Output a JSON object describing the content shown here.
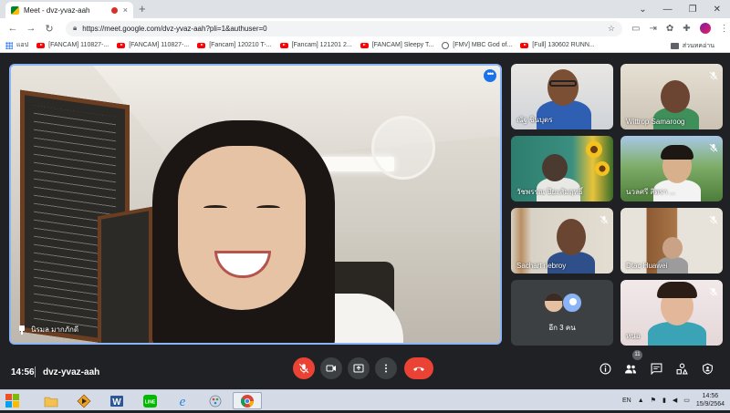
{
  "browser": {
    "tab_title": "Meet - dvz-yvaz-aah",
    "tab_close": "×",
    "new_tab": "+",
    "url": "https://meet.google.com/dvz-yvaz-aah?pli=1&authuser=0",
    "bookmarks": [
      {
        "icon": "apps-icon",
        "label": "แอป"
      },
      {
        "icon": "youtube-icon",
        "label": "[FANCAM] 110827-..."
      },
      {
        "icon": "youtube-icon",
        "label": "[FANCAM] 110827-..."
      },
      {
        "icon": "youtube-icon",
        "label": "[Fancam] 120210 T-..."
      },
      {
        "icon": "youtube-icon",
        "label": "[Fancam] 121201 2..."
      },
      {
        "icon": "youtube-icon",
        "label": "[FANCAM] Sleepy T..."
      },
      {
        "icon": "globe-icon",
        "label": "[FMV] MBC God of..."
      },
      {
        "icon": "youtube-icon",
        "label": "[Full] 130602 RUNN..."
      }
    ],
    "reading_list": "ส่วนทคอ่าน"
  },
  "meet": {
    "main_participant": "นิรมล มากภักดี",
    "participants": [
      {
        "name": "ณัฐ ชินบุตร",
        "muted": false
      },
      {
        "name": "Wittrop Samaroog",
        "muted": true
      },
      {
        "name": "วัชพรรณ ปิยะสัมฤทธิ์",
        "muted": false
      },
      {
        "name": "นวลศรี สิตรา ...",
        "muted": true
      },
      {
        "name": "Sachart riebroy",
        "muted": true
      },
      {
        "name": "Dtac Huawei",
        "muted": true
      },
      {
        "name": "หนอ",
        "muted": true
      }
    ],
    "others_label": "อีก 3 คน",
    "time": "14:56",
    "meeting_code": "dvz-yvaz-aah",
    "people_count": "11"
  },
  "taskbar": {
    "lang": "EN",
    "clock_time": "14:56",
    "clock_date": "15/9/2564"
  }
}
